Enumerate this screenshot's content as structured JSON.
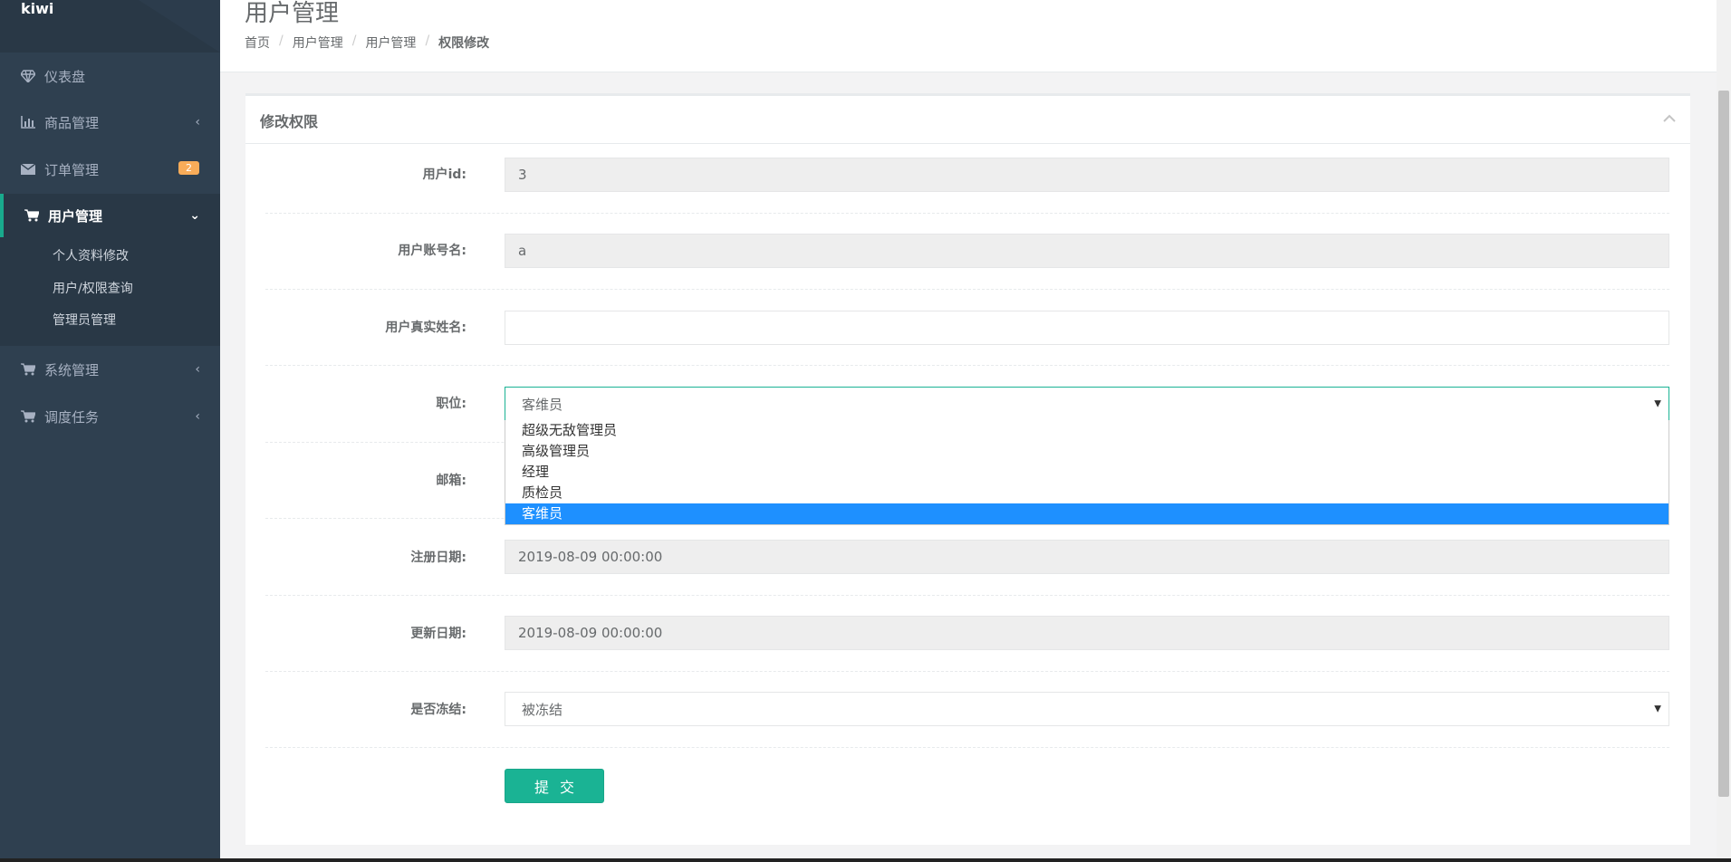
{
  "brand": "kiwi",
  "sidebar": {
    "items": [
      {
        "label": "仪表盘",
        "icon": "diamond-icon"
      },
      {
        "label": "商品管理",
        "icon": "bar-chart-icon"
      },
      {
        "label": "订单管理",
        "icon": "envelope-icon",
        "badge": "2"
      },
      {
        "label": "用户管理",
        "icon": "cart-icon"
      },
      {
        "label": "系统管理",
        "icon": "cart-icon"
      },
      {
        "label": "调度任务",
        "icon": "cart-icon"
      }
    ],
    "submenu": [
      "个人资料修改",
      "用户/权限查询",
      "管理员管理"
    ]
  },
  "header": {
    "title": "用户管理",
    "breadcrumb": [
      "首页",
      "用户管理",
      "用户管理",
      "权限修改"
    ],
    "separator": "/"
  },
  "panel": {
    "title": "修改权限",
    "fields": {
      "user_id": {
        "label": "用户id:",
        "value": "3"
      },
      "account": {
        "label": "用户账号名:",
        "value": "a"
      },
      "real_name": {
        "label": "用户真实姓名:",
        "value": ""
      },
      "position": {
        "label": "职位:",
        "value": "客维员",
        "options": [
          "超级无敌管理员",
          "高级管理员",
          "经理",
          "质检员",
          "客维员"
        ]
      },
      "email": {
        "label": "邮箱:"
      },
      "reg_date": {
        "label": "注册日期:",
        "value": "2019-08-09 00:00:00"
      },
      "update_date": {
        "label": "更新日期:",
        "value": "2019-08-09 00:00:00"
      },
      "frozen": {
        "label": "是否冻结:",
        "value": "被冻结"
      }
    },
    "submit_label": "提交"
  },
  "colors": {
    "primary": "#1ab394",
    "sidebar": "#2f4050",
    "badge": "#f8ac59",
    "highlight": "#1e90ff"
  }
}
